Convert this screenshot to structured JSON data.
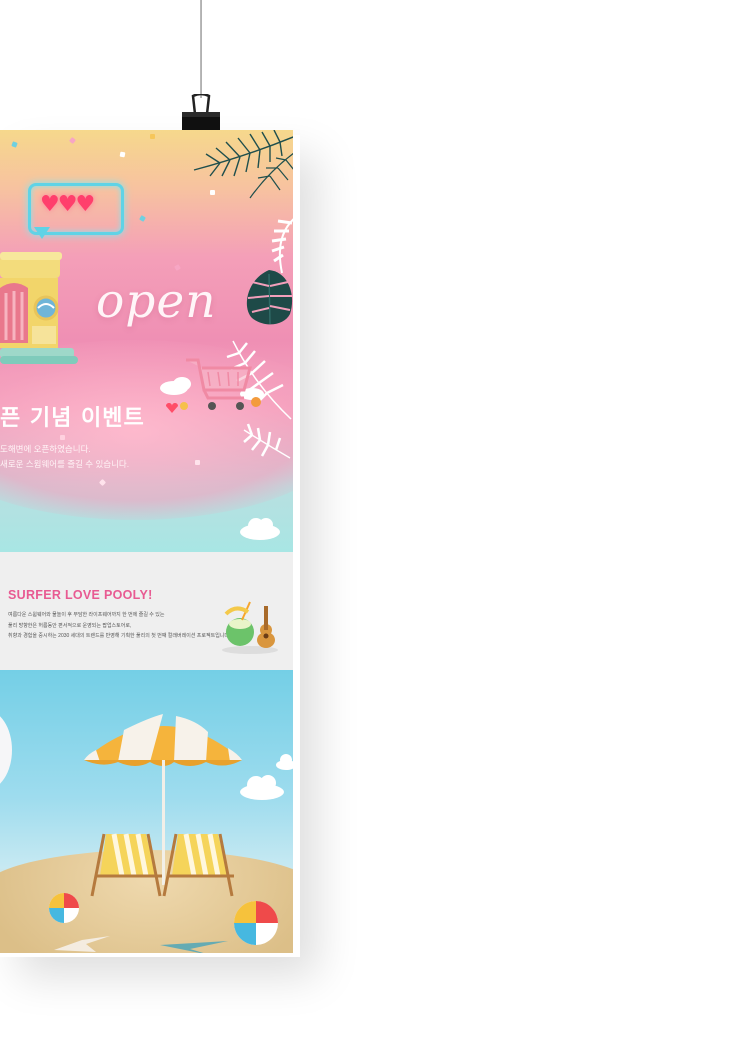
{
  "poster": {
    "hero": {
      "open_text": "open",
      "event_title": "픈 기념 이벤트",
      "desc_lines": [
        "도해변에 오픈하였습니다.",
        "새로운 스윔웨어를 즐길 수 있습니다."
      ],
      "hearts": "♥♥♥"
    },
    "band": {
      "title": "SURFER LOVE POOLY!",
      "text_lines": [
        "여름다운 스윔웨어와 물놀이 후 부담한 라이프웨어까지 한 번에 즐길 수 있는",
        "풀리 방향한은 허름동안 편서적으로 운영되는 팝업스토어로,",
        "취향과 경험을 중시하는 2030 세대의 트렌드를 반영해 기획한 풀리의 첫 번째 컬래버레이션 프로젝트입니다."
      ]
    }
  },
  "colors": {
    "accent_pink": "#e85a92",
    "neon_cyan": "#5fd3e6",
    "heart_red": "#ff3f6c",
    "band_bg": "#efefef",
    "sky_blue": "#74cfe6",
    "umbrella_yellow": "#f5b43c"
  },
  "icons": [
    "binder-clip-icon",
    "chat-bubble-icon",
    "heart-icon",
    "palm-leaf-icon",
    "monstera-leaf-icon",
    "cloud-icon",
    "shopping-cart-icon",
    "beach-umbrella-icon",
    "beach-chair-icon",
    "beach-ball-icon",
    "coconut-drink-icon",
    "ukulele-icon",
    "starfish-icon"
  ]
}
